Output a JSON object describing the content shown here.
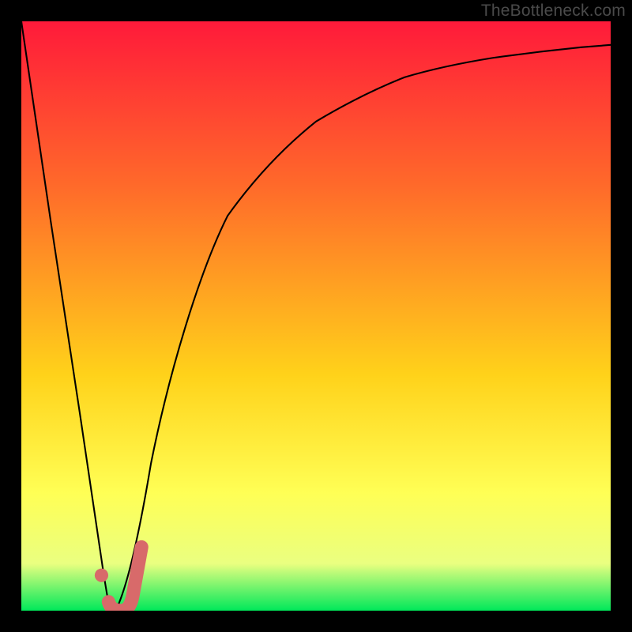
{
  "watermark": "TheBottleneck.com",
  "colors": {
    "background_frame": "#000000",
    "gradient_top": "#ff1a3a",
    "gradient_mid1": "#ff6a2a",
    "gradient_mid2": "#ffd21a",
    "gradient_mid3": "#ffff55",
    "gradient_mid4": "#eaff80",
    "gradient_bottom": "#00e85a",
    "curve": "#000000",
    "marker_stroke": "#d86a6a",
    "marker_fill": "#d86a6a"
  },
  "chart_data": {
    "type": "line",
    "title": "",
    "xlabel": "",
    "ylabel": "",
    "xlim": [
      0,
      100
    ],
    "ylim": [
      0,
      100
    ],
    "grid": false,
    "series": [
      {
        "name": "bottleneck-curve",
        "x": [
          0,
          5,
          10,
          14,
          15,
          16,
          18,
          20,
          22,
          25,
          30,
          35,
          40,
          45,
          50,
          55,
          60,
          65,
          70,
          75,
          80,
          85,
          90,
          95,
          100
        ],
        "values": [
          100,
          66,
          33,
          6,
          0,
          0,
          4,
          13,
          25,
          40,
          57,
          67,
          74,
          79,
          83,
          86,
          88.5,
          90.5,
          92,
          93,
          93.8,
          94.5,
          95.1,
          95.6,
          96
        ]
      }
    ],
    "annotations": [
      {
        "name": "optimal-marker-dot",
        "x": 13.5,
        "y": 6
      },
      {
        "name": "optimal-marker-tick",
        "x_from": 15,
        "x_to": 19.5,
        "y_from": 0,
        "y_to": 11
      }
    ]
  }
}
